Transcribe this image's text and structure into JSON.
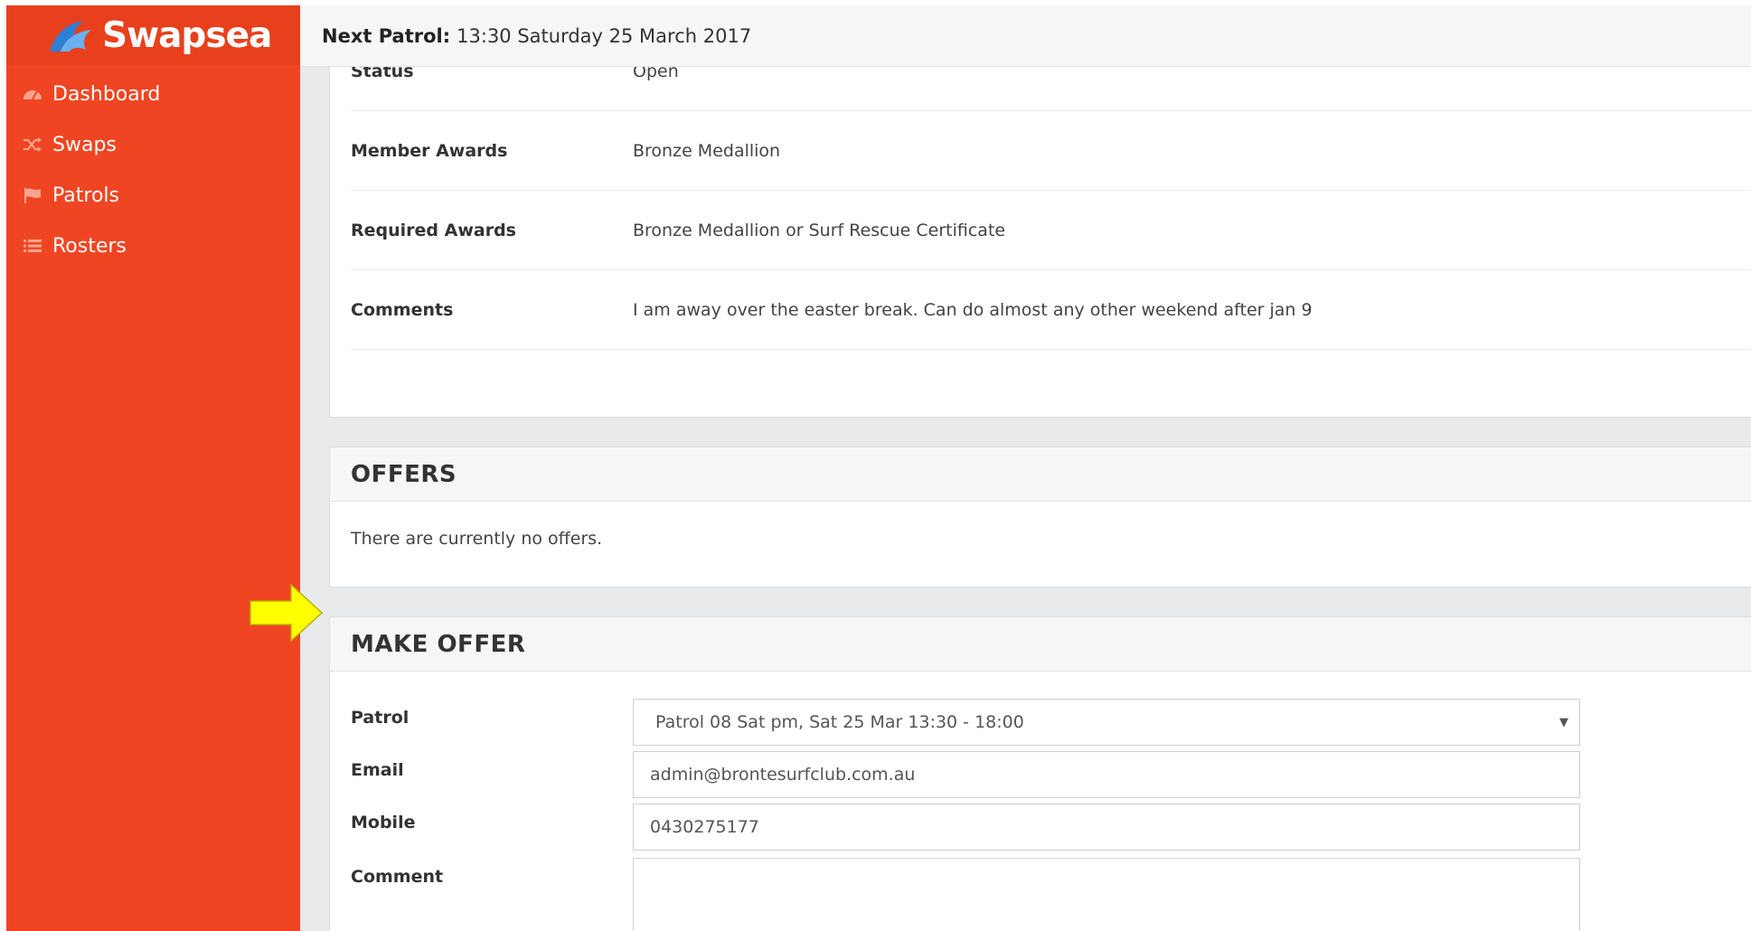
{
  "brand": {
    "name": "Swapsea",
    "accent": "#f04522"
  },
  "nav": [
    {
      "label": "Dashboard",
      "icon": "dashboard-icon"
    },
    {
      "label": "Swaps",
      "icon": "shuffle-icon"
    },
    {
      "label": "Patrols",
      "icon": "flag-icon"
    },
    {
      "label": "Rosters",
      "icon": "list-icon"
    }
  ],
  "topbar": {
    "label": "Next Patrol:",
    "value": "13:30 Saturday 25 March 2017"
  },
  "details": [
    {
      "label": "Status",
      "value": "Open"
    },
    {
      "label": "Member Awards",
      "value": "Bronze Medallion"
    },
    {
      "label": "Required Awards",
      "value": "Bronze Medallion or Surf Rescue Certificate"
    },
    {
      "label": "Comments",
      "value": "I am away over the easter break. Can do almost any other weekend after jan 9"
    }
  ],
  "offers": {
    "title": "OFFERS",
    "empty": "There are currently no offers."
  },
  "make_offer": {
    "title": "MAKE OFFER",
    "patrol_label": "Patrol",
    "patrol_value": "Patrol 08 Sat pm, Sat 25 Mar 13:30 - 18:00",
    "email_label": "Email",
    "email_value": "admin@brontesurfclub.com.au",
    "mobile_label": "Mobile",
    "mobile_value": "0430275177",
    "comment_label": "Comment",
    "comment_value": ""
  }
}
